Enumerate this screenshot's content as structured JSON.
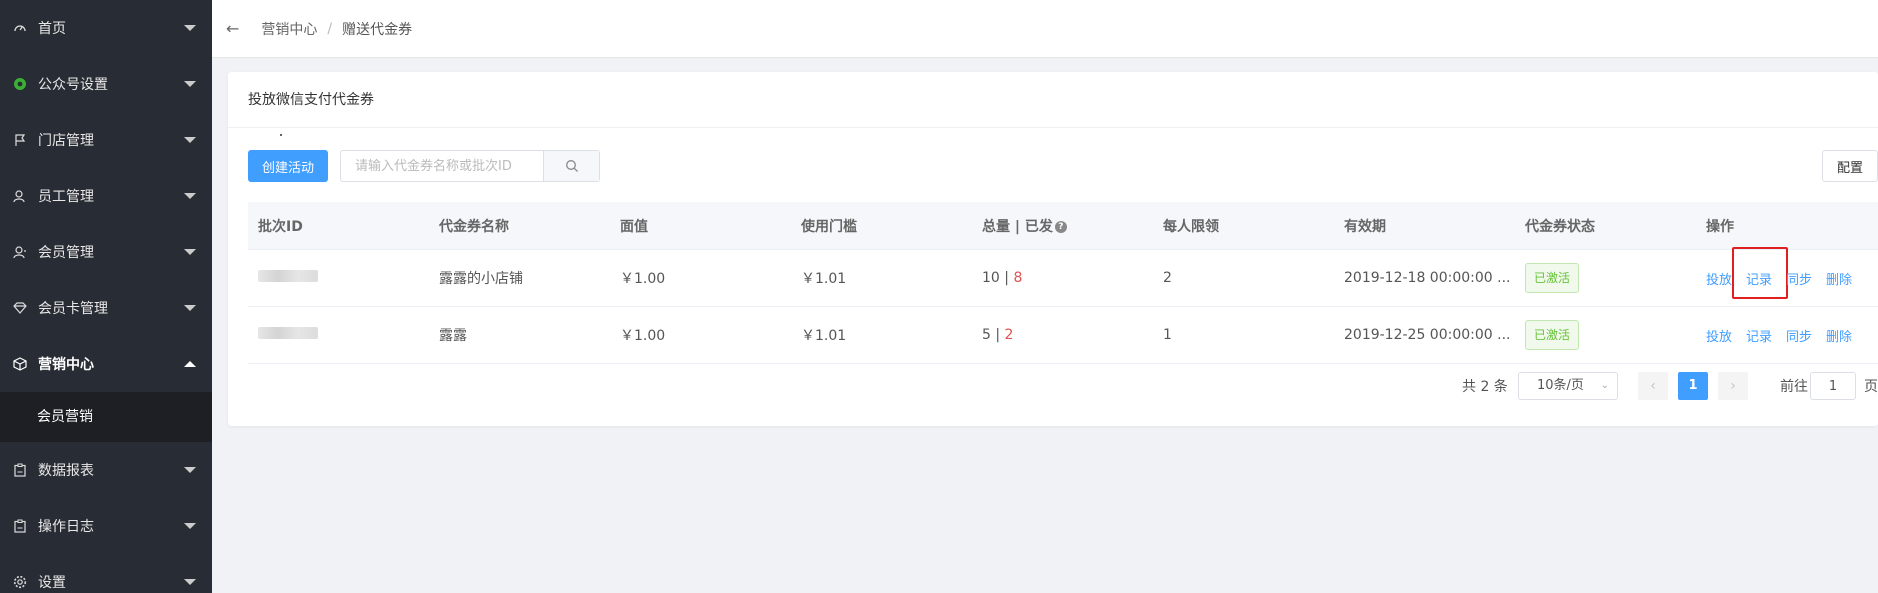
{
  "sidebar": {
    "items": [
      {
        "label": "首页",
        "icon": "dashboard-icon"
      },
      {
        "label": "公众号设置",
        "icon": "wechat-icon"
      },
      {
        "label": "门店管理",
        "icon": "flag-icon"
      },
      {
        "label": "员工管理",
        "icon": "user-icon"
      },
      {
        "label": "会员管理",
        "icon": "member-icon"
      },
      {
        "label": "会员卡管理",
        "icon": "diamond-icon"
      },
      {
        "label": "营销中心",
        "icon": "box-icon"
      },
      {
        "label": "数据报表",
        "icon": "clipboard-icon"
      },
      {
        "label": "操作日志",
        "icon": "clipboard-icon"
      },
      {
        "label": "设置",
        "icon": "gear-icon"
      }
    ],
    "submenu": {
      "label": "会员营销"
    }
  },
  "topbar": {
    "breadcrumb_parent": "营销中心",
    "breadcrumb_sep": "/",
    "breadcrumb_current": "赠送代金券"
  },
  "card": {
    "title": "投放微信支付代金券",
    "create_button": "创建活动",
    "search_placeholder": "请输入代金券名称或批次ID",
    "config_button": "配置"
  },
  "table": {
    "headers": {
      "batch_id": "批次ID",
      "name": "代金券名称",
      "face_value": "面值",
      "threshold": "使用门槛",
      "total_sent": "总量 | 已发",
      "limit": "每人限领",
      "validity": "有效期",
      "status": "代金券状态",
      "ops": "操作"
    },
    "rows": [
      {
        "name": "露露的小店铺",
        "face_value": "￥1.00",
        "threshold": "￥1.01",
        "total": "10",
        "sent": "8",
        "limit": "2",
        "validity": "2019-12-18 00:00:00 ...",
        "status": "已激活"
      },
      {
        "name": "露露",
        "face_value": "￥1.00",
        "threshold": "￥1.01",
        "total": "5",
        "sent": "2",
        "limit": "1",
        "validity": "2019-12-25 00:00:00 ...",
        "status": "已激活"
      }
    ],
    "ops": {
      "issue": "投放",
      "record": "记录",
      "sync": "同步",
      "delete": "删除"
    },
    "divider": " | "
  },
  "pagination": {
    "total": "共 2 条",
    "page_size": "10条/页",
    "current_page": "1",
    "goto_label": "前往",
    "goto_value": "1",
    "goto_suffix": "页"
  },
  "colors": {
    "sidebar_bg": "#282c34",
    "submenu_bg": "#1d1f25",
    "primary": "#409eff",
    "success": "#67c23a",
    "danger": "#e0534f",
    "highlight": "#e02020"
  }
}
